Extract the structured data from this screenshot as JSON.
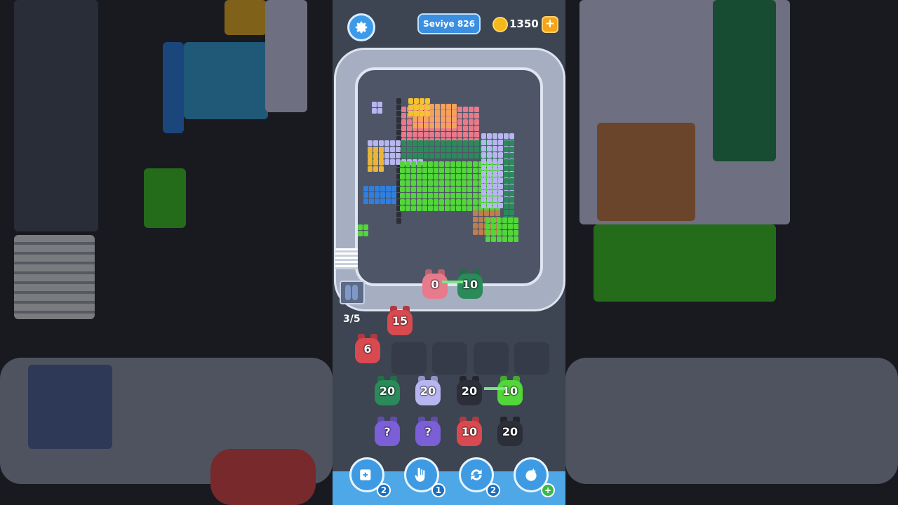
{
  "topbar": {
    "level_label": "Seviye 826",
    "coins": "1350",
    "plus_label": "+"
  },
  "colors": {
    "pink": "#e77a8b",
    "green": "#2a8a5a",
    "lightgreen": "#52d63a",
    "lavender": "#b8b6f0",
    "black": "#2c2f38",
    "red": "#d84a4f",
    "purple": "#7a5fd6"
  },
  "track": {
    "pigs": [
      {
        "value": "0",
        "color": "pink"
      },
      {
        "value": "10",
        "color": "green"
      }
    ],
    "queue_counter": "3/5"
  },
  "launcher": {
    "pigs": [
      {
        "value": "15",
        "color": "red"
      },
      {
        "value": "6",
        "color": "red"
      }
    ]
  },
  "grid": {
    "row1": [
      {
        "value": "20",
        "color": "green"
      },
      {
        "value": "20",
        "color": "lavender"
      },
      {
        "value": "20",
        "color": "black"
      },
      {
        "value": "10",
        "color": "lightgreen"
      }
    ],
    "row2": [
      {
        "value": "?",
        "color": "purple"
      },
      {
        "value": "?",
        "color": "purple"
      },
      {
        "value": "10",
        "color": "red"
      },
      {
        "value": "20",
        "color": "black"
      }
    ]
  },
  "boosters": [
    {
      "name": "add-slot",
      "count": "2",
      "icon": "add-slot-icon"
    },
    {
      "name": "hand",
      "count": "1",
      "icon": "hand-icon"
    },
    {
      "name": "shuffle",
      "count": "2",
      "icon": "shuffle-icon"
    },
    {
      "name": "magic",
      "count": "+",
      "icon": "magic-icon"
    }
  ]
}
